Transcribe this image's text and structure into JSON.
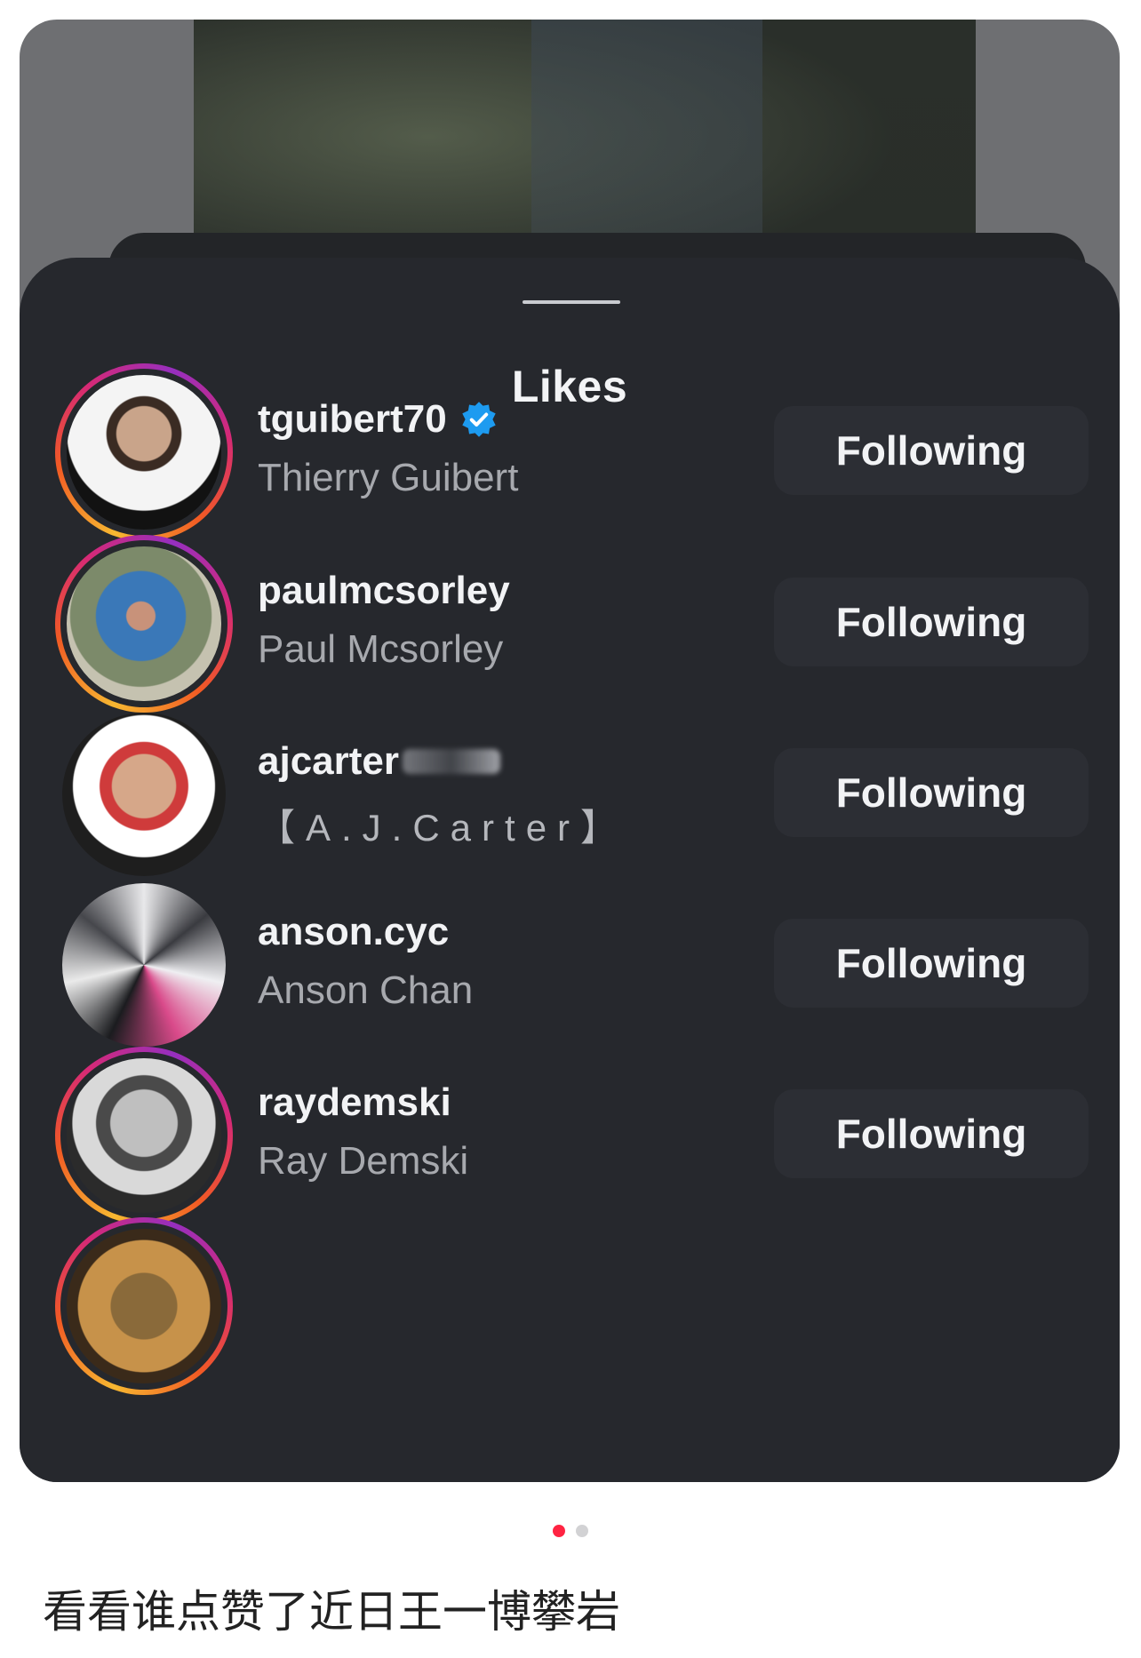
{
  "sheet": {
    "title": "Likes",
    "users": [
      {
        "username": "tguibert70",
        "full_name": "Thierry Guibert",
        "verified": true,
        "button_label": "Following",
        "story_ring": true
      },
      {
        "username": "paulmcsorley",
        "full_name": "Paul Mcsorley",
        "verified": false,
        "button_label": "Following",
        "story_ring": true
      },
      {
        "username": "ajcarter",
        "full_name": "【A.J.Carter】",
        "verified": false,
        "button_label": "Following",
        "story_ring": false
      },
      {
        "username": "anson.cyc",
        "full_name": "Anson Chan",
        "verified": false,
        "button_label": "Following",
        "story_ring": false
      },
      {
        "username": "raydemski",
        "full_name": "Ray Demski",
        "verified": false,
        "button_label": "Following",
        "story_ring": true
      }
    ]
  },
  "carousel": {
    "total": 2,
    "active_index": 0
  },
  "caption": "看看谁点赞了近日王一博攀岩",
  "colors": {
    "sheet_bg": "#26282d",
    "button_bg": "#2c2e34",
    "verified_blue": "#1d9bf0",
    "dot_active": "#ff2442",
    "dot_inactive": "#d2d2d4"
  }
}
